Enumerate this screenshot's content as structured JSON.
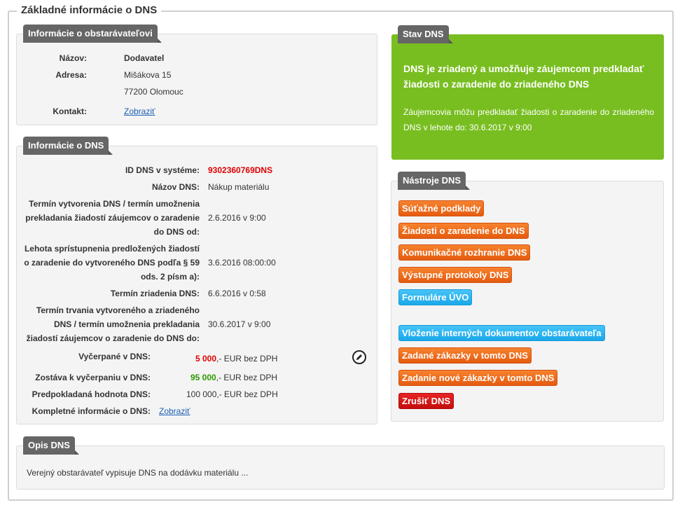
{
  "legend": "Základné informácie o DNS",
  "supplier": {
    "tab": "Informácie o obstarávateľovi",
    "name_label": "Názov:",
    "name": "Dodavatel",
    "address_label": "Adresa:",
    "address_line1": "Mišákova 15",
    "address_line2": "77200 Olomouc",
    "contact_label": "Kontakt:",
    "contact_link": "Zobraziť"
  },
  "dns": {
    "tab": "Informácie o DNS",
    "id_label": "ID DNS v systéme:",
    "id": "9302360769DNS",
    "name_label": "Názov DNS:",
    "name": "Nákup materiálu",
    "created_label_1": "Termín vytvorenia DNS / termín umožnenia",
    "created_label_2": "prekladania žiadostí záujemcov o zaradenie",
    "created_label_3": "do DNS od:",
    "created": "2.6.2016 v 9:00",
    "deadline_label_1": "Lehota sprístupnenia predložených žiadostí",
    "deadline_label_2": "o zaradenie do vytvoreného DNS podľa § 59",
    "deadline_label_3": "ods. 2 písm a):",
    "deadline": "3.6.2016 08:00:00",
    "established_label": "Termín zriadenia DNS:",
    "established": "6.6.2016 v 0:58",
    "duration_label_1": "Termín trvania vytvoreného a zriadeného",
    "duration_label_2": "DNS / termín umožnenia prekladania",
    "duration_label_3": "žiadostí záujemcov o zaradenie do DNS do:",
    "duration": "30.6.2017 v 9:00",
    "spent_label": "Vyčerpané v DNS:",
    "spent_amount": "5 000",
    "spent_suffix": ",- EUR bez DPH",
    "remaining_label": "Zostáva k vyčerpaniu v DNS:",
    "remaining_amount": "95 000",
    "remaining_suffix": ",- EUR bez DPH",
    "expected_label": "Predpokladaná hodnota DNS:",
    "expected": "100 000,- EUR bez DPH",
    "full_info_label": "Kompletné informácie o DNS:",
    "full_info_link": "Zobraziť"
  },
  "status": {
    "tab": "Stav DNS",
    "heading": "DNS je zriadený a umožňuje záujemcom predkladať žiadosti o zaradenie do zriadeného DNS",
    "text": "Záujemcovia môžu predkladať žiadosti o zaradenie do zriadeného DNS v lehote do: 30.6.2017 v 9:00",
    "color": "#78be20"
  },
  "tools": {
    "tab": "Nástroje DNS",
    "buttons": [
      "Súťažné podklady",
      "Žiadosti o zaradenie do DNS",
      "Komunikačné rozhranie DNS",
      "Výstupné protokoly DNS",
      "Formuláre ÚVO",
      "Vloženie interných dokumentov obstarávateľa",
      "Zadané zákazky v tomto DNS",
      "Zadanie nové zákazky v tomto DNS",
      "Zrušiť DNS"
    ]
  },
  "description": {
    "tab": "Opis DNS",
    "text": "Verejný obstarávateľ vypisuje DNS na dodávku materiálu ..."
  }
}
